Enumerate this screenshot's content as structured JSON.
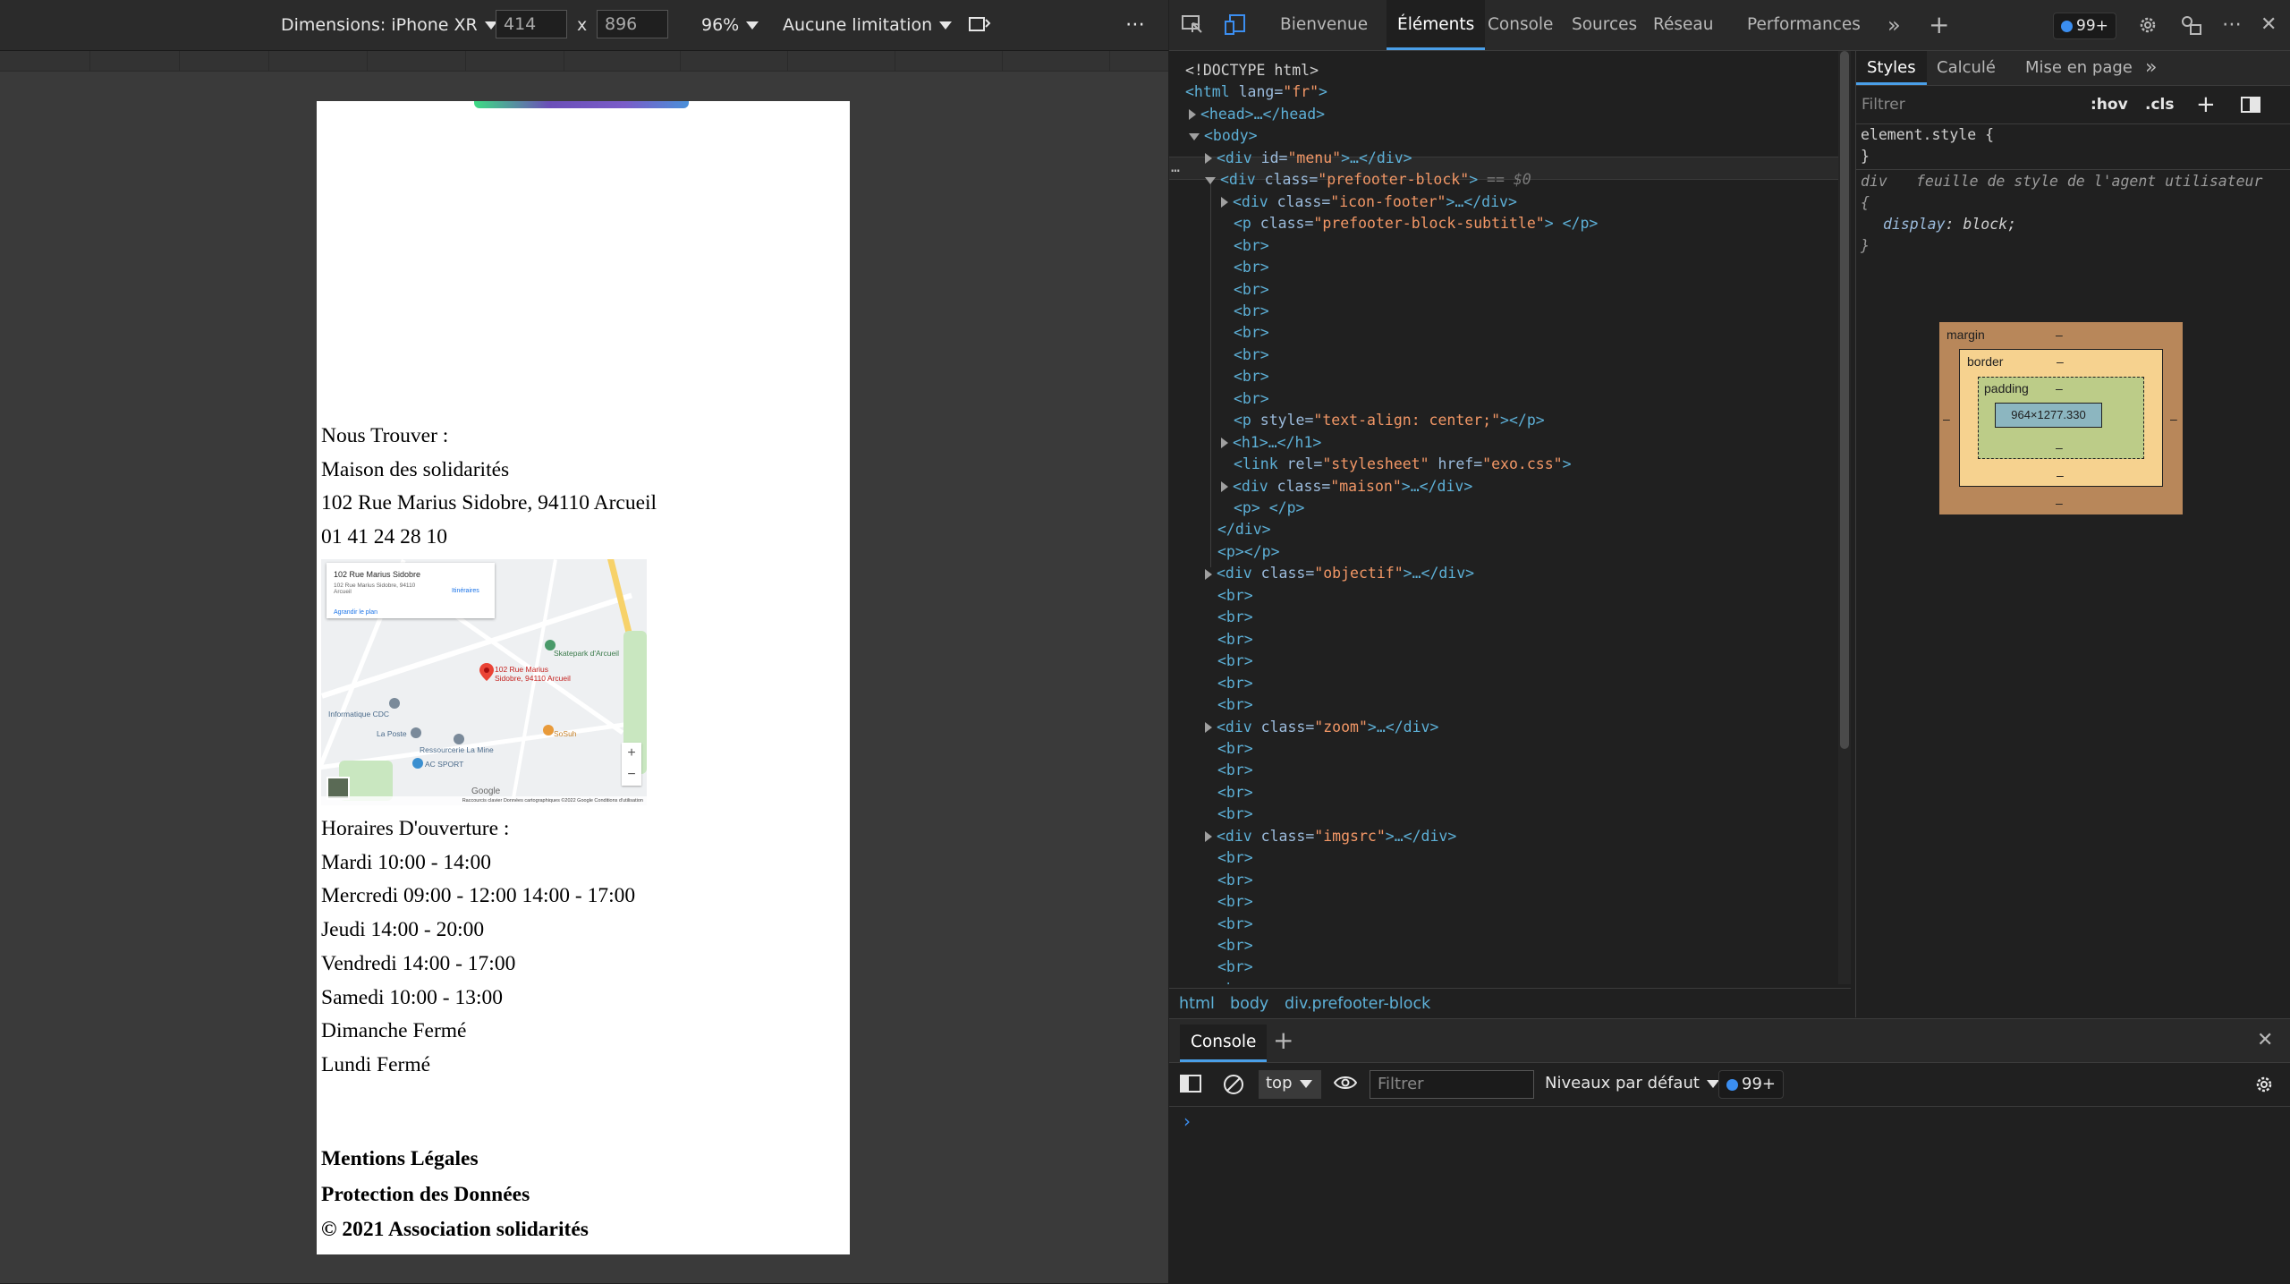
{
  "device_toolbar": {
    "dimensions_label": "Dimensions: iPhone XR",
    "width": "414",
    "times": "x",
    "height": "896",
    "zoom": "96%",
    "throttling": "Aucune limitation",
    "more": "⋯"
  },
  "phone_page": {
    "find_us": [
      "Nous Trouver :",
      "Maison des solidarités",
      "102 Rue Marius Sidobre, 94110 Arcueil",
      "01 41 24 28 10"
    ],
    "map": {
      "card_title": "102 Rue Marius Sidobre",
      "card_address": "102 Rue Marius Sidobre, 94110 Arcueil",
      "card_link": "Agrandir le plan",
      "card_directions": "Itinéraires",
      "pin_label": "102 Rue Marius Sidobre, 94110 Arcueil",
      "poi": [
        "Informatique CDC",
        "La Poste",
        "Ressourcerie La Mine",
        "AC SPORT",
        "Skatepark d'Arcueil",
        "SoSuh"
      ],
      "google": "Google",
      "footer": "Raccourcis clavier   Données cartographiques ©2022 Google   Conditions d'utilisation",
      "zoom_in": "+",
      "zoom_out": "−"
    },
    "hours": [
      "Horaires D'ouverture :",
      "Mardi 10:00 - 14:00",
      "Mercredi 09:00 - 12:00 14:00 - 17:00",
      "Jeudi 14:00 - 20:00",
      "Vendredi 14:00 - 17:00",
      "Samedi 10:00 - 13:00",
      "Dimanche Fermé",
      "Lundi Fermé"
    ],
    "footer_links": [
      "Mentions Légales",
      "Protection des Données",
      "© 2021 Association solidarités"
    ]
  },
  "devtools": {
    "tabs": [
      "Bienvenue",
      "Éléments",
      "Console",
      "Sources",
      "Réseau",
      "Performances"
    ],
    "active_tab": "Éléments",
    "issues_count": "99+",
    "more": "»",
    "add": "+",
    "dots": "⋯",
    "close": "✕"
  },
  "elements_tree": [
    {
      "indent": 0,
      "tri": "",
      "open": "<!DOCTYPE html>",
      "attrs": [],
      "tail": ""
    },
    {
      "indent": 0,
      "tri": "",
      "open": "<html",
      "attrs": [
        [
          "lang",
          "\"fr\""
        ]
      ],
      "tail": ">"
    },
    {
      "indent": 1,
      "tri": "r",
      "open": "<head>",
      "attrs": [],
      "tail": "…</head>"
    },
    {
      "indent": 1,
      "tri": "d",
      "open": "<body>",
      "attrs": [],
      "tail": ""
    },
    {
      "indent": 2,
      "tri": "r",
      "open": "<div",
      "attrs": [
        [
          "id",
          "\"menu\""
        ]
      ],
      "tail": ">…</div>"
    },
    {
      "indent": 2,
      "tri": "d",
      "open": "<div",
      "attrs": [
        [
          "class",
          "\"prefooter-block\""
        ]
      ],
      "tail": ">",
      "selected": true,
      "marker": "== $0"
    },
    {
      "indent": 3,
      "tri": "r",
      "open": "<div",
      "attrs": [
        [
          "class",
          "\"icon-footer\""
        ]
      ],
      "tail": ">…</div>"
    },
    {
      "indent": 3,
      "tri": "",
      "open": "<p",
      "attrs": [
        [
          "class",
          "\"prefooter-block-subtitle\""
        ]
      ],
      "tail": "> </p>"
    },
    {
      "indent": 3,
      "tri": "",
      "open": "<br>",
      "attrs": [],
      "tail": ""
    },
    {
      "indent": 3,
      "tri": "",
      "open": "<br>",
      "attrs": [],
      "tail": ""
    },
    {
      "indent": 3,
      "tri": "",
      "open": "<br>",
      "attrs": [],
      "tail": ""
    },
    {
      "indent": 3,
      "tri": "",
      "open": "<br>",
      "attrs": [],
      "tail": ""
    },
    {
      "indent": 3,
      "tri": "",
      "open": "<br>",
      "attrs": [],
      "tail": ""
    },
    {
      "indent": 3,
      "tri": "",
      "open": "<br>",
      "attrs": [],
      "tail": ""
    },
    {
      "indent": 3,
      "tri": "",
      "open": "<br>",
      "attrs": [],
      "tail": ""
    },
    {
      "indent": 3,
      "tri": "",
      "open": "<br>",
      "attrs": [],
      "tail": ""
    },
    {
      "indent": 3,
      "tri": "",
      "open": "<p",
      "attrs": [
        [
          "style",
          "\"text-align: center;\""
        ]
      ],
      "tail": "></p>"
    },
    {
      "indent": 3,
      "tri": "r",
      "open": "<h1>",
      "attrs": [],
      "tail": "…</h1>"
    },
    {
      "indent": 3,
      "tri": "",
      "open": "<link",
      "attrs": [
        [
          "rel",
          "\"stylesheet\""
        ],
        [
          "href",
          "\"exo.css\""
        ]
      ],
      "tail": ">"
    },
    {
      "indent": 3,
      "tri": "r",
      "open": "<div",
      "attrs": [
        [
          "class",
          "\"maison\""
        ]
      ],
      "tail": ">…</div>"
    },
    {
      "indent": 3,
      "tri": "",
      "open": "<p>",
      "attrs": [],
      "tail": " </p>"
    },
    {
      "indent": 2,
      "tri": "",
      "open": "</div>",
      "attrs": [],
      "tail": ""
    },
    {
      "indent": 2,
      "tri": "",
      "open": "<p></p>",
      "attrs": [],
      "tail": ""
    },
    {
      "indent": 2,
      "tri": "r",
      "open": "<div",
      "attrs": [
        [
          "class",
          "\"objectif\""
        ]
      ],
      "tail": ">…</div>"
    },
    {
      "indent": 2,
      "tri": "",
      "open": "<br>",
      "attrs": [],
      "tail": ""
    },
    {
      "indent": 2,
      "tri": "",
      "open": "<br>",
      "attrs": [],
      "tail": ""
    },
    {
      "indent": 2,
      "tri": "",
      "open": "<br>",
      "attrs": [],
      "tail": ""
    },
    {
      "indent": 2,
      "tri": "",
      "open": "<br>",
      "attrs": [],
      "tail": ""
    },
    {
      "indent": 2,
      "tri": "",
      "open": "<br>",
      "attrs": [],
      "tail": ""
    },
    {
      "indent": 2,
      "tri": "",
      "open": "<br>",
      "attrs": [],
      "tail": ""
    },
    {
      "indent": 2,
      "tri": "r",
      "open": "<div",
      "attrs": [
        [
          "class",
          "\"zoom\""
        ]
      ],
      "tail": ">…</div>"
    },
    {
      "indent": 2,
      "tri": "",
      "open": "<br>",
      "attrs": [],
      "tail": ""
    },
    {
      "indent": 2,
      "tri": "",
      "open": "<br>",
      "attrs": [],
      "tail": ""
    },
    {
      "indent": 2,
      "tri": "",
      "open": "<br>",
      "attrs": [],
      "tail": ""
    },
    {
      "indent": 2,
      "tri": "",
      "open": "<br>",
      "attrs": [],
      "tail": ""
    },
    {
      "indent": 2,
      "tri": "r",
      "open": "<div",
      "attrs": [
        [
          "class",
          "\"imgsrc\""
        ]
      ],
      "tail": ">…</div>"
    },
    {
      "indent": 2,
      "tri": "",
      "open": "<br>",
      "attrs": [],
      "tail": ""
    },
    {
      "indent": 2,
      "tri": "",
      "open": "<br>",
      "attrs": [],
      "tail": ""
    },
    {
      "indent": 2,
      "tri": "",
      "open": "<br>",
      "attrs": [],
      "tail": ""
    },
    {
      "indent": 2,
      "tri": "",
      "open": "<br>",
      "attrs": [],
      "tail": ""
    },
    {
      "indent": 2,
      "tri": "",
      "open": "<br>",
      "attrs": [],
      "tail": ""
    },
    {
      "indent": 2,
      "tri": "",
      "open": "<br>",
      "attrs": [],
      "tail": ""
    },
    {
      "indent": 2,
      "tri": "",
      "open": "<br>",
      "attrs": [],
      "tail": ""
    }
  ],
  "breadcrumb": [
    "html",
    "body",
    "div.prefooter-block"
  ],
  "styles": {
    "tabs": [
      "Styles",
      "Calculé",
      "Mise en page"
    ],
    "active_tab": "Styles",
    "more": "»",
    "filter_placeholder": "Filtrer",
    "hov": ":hov",
    "cls": ".cls",
    "rule1_selector": "element.style {",
    "rule1_close": "}",
    "rule2_selector": "div",
    "rule2_source": "feuille de style de l'agent utilisateur",
    "rule2_open": "{",
    "rule2_prop": "display",
    "rule2_value": "block;",
    "rule2_close": "}",
    "box_model": {
      "margin": "margin",
      "border": "border",
      "padding": "padding",
      "content": "964×1277.330",
      "dash": "–"
    }
  },
  "drawer": {
    "tab": "Console",
    "add": "+",
    "close": "✕",
    "context": "top",
    "filter_placeholder": "Filtrer",
    "levels": "Niveaux par défaut",
    "issues": "99+",
    "prompt": "›"
  },
  "colors": {
    "accent": "#4a9fe8",
    "tag": "#5db0d7",
    "attr_value": "#f29766",
    "issue_badge": "#3b8ef0",
    "box_margin": "#b8875a",
    "box_border": "#f6d28f",
    "box_padding": "#bccc88",
    "box_content": "#8cb6c0"
  }
}
